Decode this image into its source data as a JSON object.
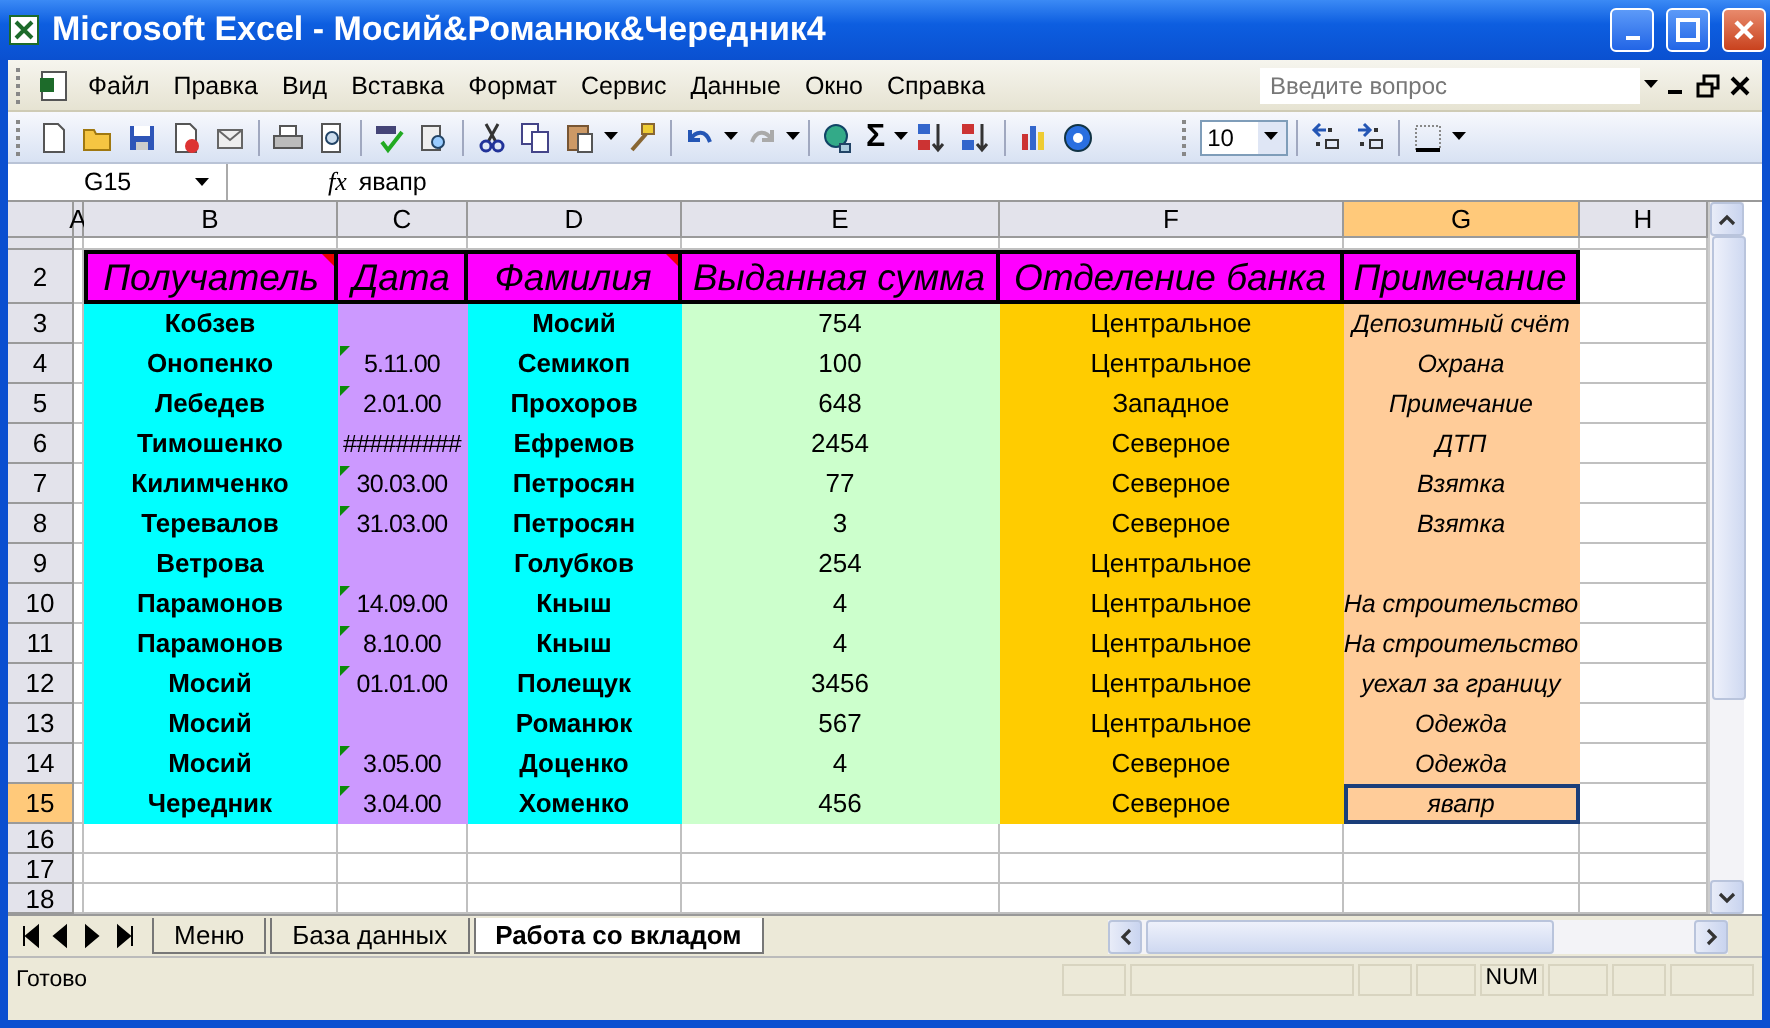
{
  "window": {
    "title": "Microsoft Excel - Мосий&Романюк&Чередник4"
  },
  "menu": [
    "Файл",
    "Правка",
    "Вид",
    "Вставка",
    "Формат",
    "Сервис",
    "Данные",
    "Окно",
    "Справка"
  ],
  "help_search": {
    "placeholder": "Введите вопрос"
  },
  "toolbar": {
    "sum_symbol": "Σ",
    "font_size": "10"
  },
  "formula_bar": {
    "name_box": "G15",
    "function_label": "fx",
    "value": "явапр"
  },
  "columns": [
    {
      "letter": "A",
      "selected": false
    },
    {
      "letter": "B",
      "selected": false,
      "color": "#00ffff"
    },
    {
      "letter": "C",
      "selected": false,
      "color": "#cc99ff"
    },
    {
      "letter": "D",
      "selected": false,
      "color": "#00ffff"
    },
    {
      "letter": "E",
      "selected": false,
      "color": "#ccffcc"
    },
    {
      "letter": "F",
      "selected": false,
      "color": "#ffcc00"
    },
    {
      "letter": "G",
      "selected": true,
      "color": "#ffcc99"
    },
    {
      "letter": "H",
      "selected": false
    }
  ],
  "rows": [
    {
      "number": "2",
      "kind": "heading",
      "selected": false,
      "color": "#ff00ff",
      "cells": [
        {
          "text": "Получатель",
          "comment": true
        },
        {
          "text": "Дата",
          "comment": false
        },
        {
          "text": "Фамилия",
          "comment": true
        },
        {
          "text": "Выданная сумма",
          "comment": false
        },
        {
          "text": "Отделение банка",
          "comment": false
        },
        {
          "text": "Примечание",
          "comment": false
        }
      ]
    },
    {
      "number": "3",
      "kind": "data",
      "selected": false,
      "cells": [
        {
          "text": "Кобзев"
        },
        {
          "flagged": false
        },
        {
          "text": "Мосий"
        },
        {
          "text": "754"
        },
        {
          "text": "Центральное"
        },
        {
          "text": "Депозитный счёт"
        }
      ]
    },
    {
      "number": "4",
      "kind": "data",
      "selected": false,
      "cells": [
        {
          "text": "Онопенко"
        },
        {
          "text": "5.11.00",
          "flagged": true
        },
        {
          "text": "Семикоп"
        },
        {
          "text": "100"
        },
        {
          "text": "Центральное"
        },
        {
          "text": "Охрана"
        }
      ]
    },
    {
      "number": "5",
      "kind": "data",
      "selected": false,
      "cells": [
        {
          "text": "Лебедев"
        },
        {
          "text": "2.01.00",
          "flagged": true
        },
        {
          "text": "Прохоров"
        },
        {
          "text": "648"
        },
        {
          "text": "Западное"
        },
        {
          "text": "Примечание"
        }
      ]
    },
    {
      "number": "6",
      "kind": "data",
      "selected": false,
      "cells": [
        {
          "text": "Тимошенко"
        },
        {
          "text": "#########",
          "flagged": false
        },
        {
          "text": "Ефремов"
        },
        {
          "text": "2454"
        },
        {
          "text": "Северное"
        },
        {
          "text": "ДТП"
        }
      ]
    },
    {
      "number": "7",
      "kind": "data",
      "selected": false,
      "cells": [
        {
          "text": "Килимченко"
        },
        {
          "text": "30.03.00",
          "flagged": true
        },
        {
          "text": "Петросян"
        },
        {
          "text": "77"
        },
        {
          "text": "Северное"
        },
        {
          "text": "Взятка"
        }
      ]
    },
    {
      "number": "8",
      "kind": "data",
      "selected": false,
      "cells": [
        {
          "text": "Теревалов"
        },
        {
          "text": "31.03.00",
          "flagged": true
        },
        {
          "text": "Петросян"
        },
        {
          "text": "3"
        },
        {
          "text": "Северное"
        },
        {
          "text": "Взятка"
        }
      ]
    },
    {
      "number": "9",
      "kind": "data",
      "selected": false,
      "cells": [
        {
          "text": "Ветрова"
        },
        {
          "flagged": false
        },
        {
          "text": "Голубков"
        },
        {
          "text": "254"
        },
        {
          "text": "Центральное"
        },
        {}
      ]
    },
    {
      "number": "10",
      "kind": "data",
      "selected": false,
      "cells": [
        {
          "text": "Парамонов"
        },
        {
          "text": "14.09.00",
          "flagged": true
        },
        {
          "text": "Кныш"
        },
        {
          "text": "4"
        },
        {
          "text": "Центральное"
        },
        {
          "text": "На строительство"
        }
      ]
    },
    {
      "number": "11",
      "kind": "data",
      "selected": false,
      "cells": [
        {
          "text": "Парамонов"
        },
        {
          "text": "8.10.00",
          "flagged": true
        },
        {
          "text": "Кныш"
        },
        {
          "text": "4"
        },
        {
          "text": "Центральное"
        },
        {
          "text": "На строительство"
        }
      ]
    },
    {
      "number": "12",
      "kind": "data",
      "selected": false,
      "cells": [
        {
          "text": "Мосий"
        },
        {
          "text": "01.01.00",
          "flagged": true
        },
        {
          "text": "Полещук"
        },
        {
          "text": "3456"
        },
        {
          "text": "Центральное"
        },
        {
          "text": "уехал за границу"
        }
      ]
    },
    {
      "number": "13",
      "kind": "data",
      "selected": false,
      "cells": [
        {
          "text": "Мосий"
        },
        {
          "flagged": false
        },
        {
          "text": "Романюк"
        },
        {
          "text": "567"
        },
        {
          "text": "Центральное"
        },
        {
          "text": "Одежда"
        }
      ]
    },
    {
      "number": "14",
      "kind": "data",
      "selected": false,
      "cells": [
        {
          "text": "Мосий"
        },
        {
          "text": "3.05.00",
          "flagged": true
        },
        {
          "text": "Доценко"
        },
        {
          "text": "4"
        },
        {
          "text": "Северное"
        },
        {
          "text": "Одежда"
        }
      ]
    },
    {
      "number": "15",
      "kind": "data",
      "selected": true,
      "cells": [
        {
          "text": "Чередник"
        },
        {
          "text": "3.04.00",
          "flagged": true
        },
        {
          "text": "Хоменко"
        },
        {
          "text": "456"
        },
        {
          "text": "Северное"
        },
        {
          "text": "явапр"
        }
      ]
    },
    {
      "number": "16",
      "kind": "blank",
      "selected": false
    },
    {
      "number": "17",
      "kind": "blank",
      "selected": false
    },
    {
      "number": "18",
      "kind": "blank",
      "selected": false
    }
  ],
  "sheet_tabs": [
    {
      "label": "Меню",
      "selected": false
    },
    {
      "label": "База данных",
      "selected": false
    },
    {
      "label": "Работа со вкладом",
      "selected": true
    }
  ],
  "status_bar": {
    "status": "Готово",
    "indicator": "NUM"
  }
}
